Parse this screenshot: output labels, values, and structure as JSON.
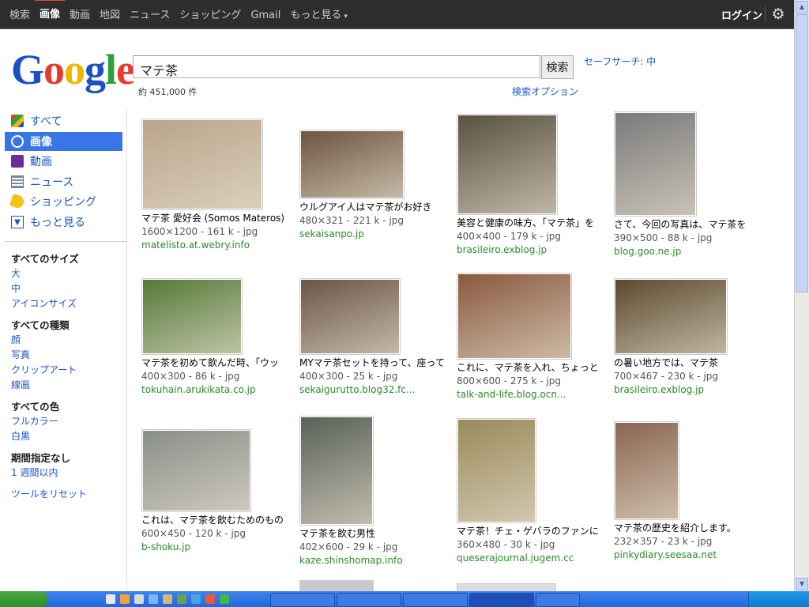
{
  "topnav": {
    "items": [
      "検索",
      "画像",
      "動画",
      "地図",
      "ニュース",
      "ショッピング",
      "Gmail",
      "もっと見る"
    ],
    "more_caret": "▾",
    "login": "ログイン",
    "gear": "⚙"
  },
  "logo": {
    "letters": [
      "G",
      "o",
      "o",
      "g",
      "l",
      "e"
    ]
  },
  "search": {
    "query": "マテ茶",
    "button": "検索",
    "safe_search": "セーフサーチ: 中",
    "count": "約 451,000 件",
    "options": "検索オプション"
  },
  "sidebar": {
    "nav": [
      "すべて",
      "画像",
      "動画",
      "ニュース",
      "ショッピング",
      "もっと見る"
    ],
    "size_head": "すべてのサイズ",
    "sizes": [
      "大",
      "中",
      "アイコンサイズ"
    ],
    "type_head": "すべての種類",
    "types": [
      "顔",
      "写真",
      "クリップアート",
      "線画"
    ],
    "color_head": "すべての色",
    "colors": [
      "フルカラー",
      "白黒"
    ],
    "time_head": "期間指定なし",
    "times": [
      "1 週間以内"
    ],
    "reset": "ツールをリセット"
  },
  "results": [
    {
      "caption": "マテ茶 愛好会 (Somos Materos)",
      "meta": "1600×1200 - 161 k - jpg",
      "source": "matelisto.at.webry.info",
      "color": "#b9a48a"
    },
    {
      "caption": "ウルグアイ人はマテ茶がお好き",
      "meta": "480×321 - 221 k - jpg",
      "source": "sekaisanpo.jp",
      "color": "#6d5540"
    },
    {
      "caption": "美容と健康の味方、「マテ茶」を",
      "meta": "400×400 - 179 k - jpg",
      "source": "brasileiro.exblog.jp",
      "color": "#5a5240"
    },
    {
      "caption": "さて、今回の写真は、マテ茶を",
      "meta": "390×500 - 88 k - jpg",
      "source": "blog.goo.ne.jp",
      "color": "#7a7a7a"
    },
    {
      "caption": "マテ茶を初めて飲んだ時、「ウッ",
      "meta": "400×300 - 86 k - jpg",
      "source": "tokuhain.arukikata.co.jp",
      "color": "#557a38"
    },
    {
      "caption": "MYマテ茶セットを持って、座って",
      "meta": "400×300 - 25 k - jpg",
      "source": "sekaigurutto.blog32.fc...",
      "color": "#6a5546"
    },
    {
      "caption": "これに、マテ茶を入れ、ちょっと",
      "meta": "800×600 - 275 k - jpg",
      "source": "talk-and-life.blog.ocn...",
      "color": "#8a5a3e"
    },
    {
      "caption": "の暑い地方では、マテ茶",
      "meta": "700×467 - 230 k - jpg",
      "source": "brasileiro.exblog.jp",
      "color": "#5b4a2e"
    },
    {
      "caption": "これは、マテ茶を飲むためのもの",
      "meta": "600×450 - 120 k - jpg",
      "source": "b-shoku.jp",
      "color": "#8a8f8a"
    },
    {
      "caption": "マテ茶を飲む男性",
      "meta": "402×600 - 29 k - jpg",
      "source": "kaze.shinshomap.info",
      "color": "#5a6258"
    },
    {
      "caption": "マテ茶！チェ・ゲバラのファンに",
      "meta": "360×480 - 30 k - jpg",
      "source": "queserajournal.jugem.cc",
      "color": "#9a8a5a"
    },
    {
      "caption": "マテ茶の歴史を紹介します。",
      "meta": "232×357 - 23 k - jpg",
      "source": "pinkydiary.seesaa.net",
      "color": "#8a6650"
    }
  ]
}
